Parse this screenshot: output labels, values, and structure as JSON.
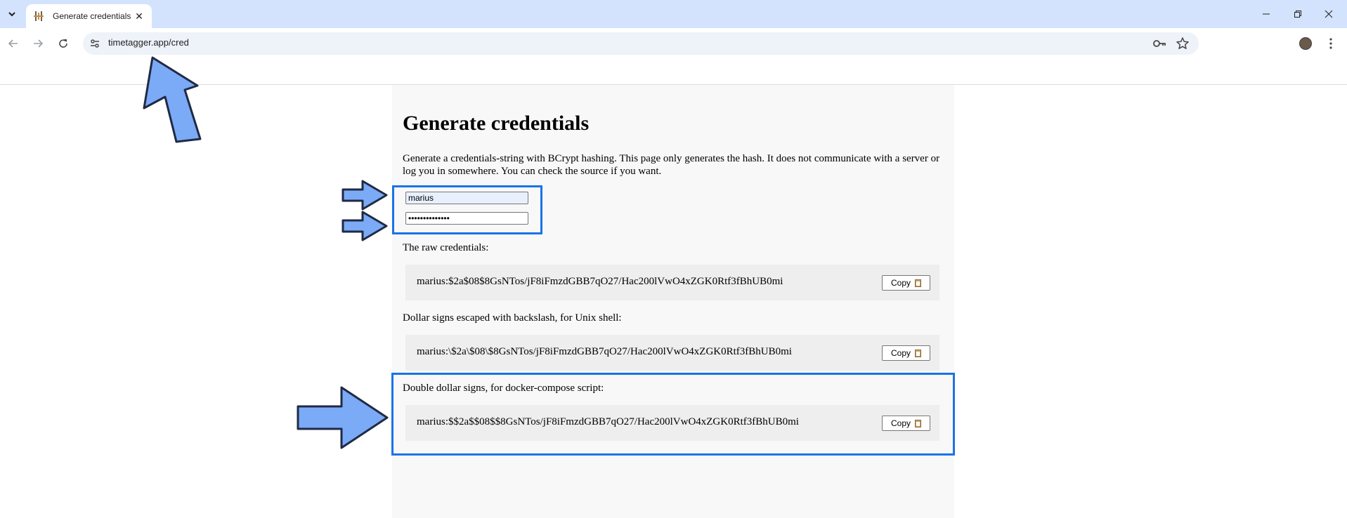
{
  "browser": {
    "tab_title": "Generate credentials",
    "tab_close": "✕",
    "url": "timetagger.app/cred"
  },
  "page": {
    "title": "Generate credentials",
    "intro": "Generate a credentials-string with BCrypt hashing. This page only generates the hash. It does not communicate with a server or log you in somewhere. You can check the source if you want.",
    "username_value": "marius",
    "password_value": "••••••••••••••",
    "raw_label": "The raw credentials:",
    "raw_value": "marius:$2a$08$8GsNTos/jF8iFmzdGBB7qO27/Hac200lVwO4xZGK0Rtf3fBhUB0mi",
    "escaped_label": "Dollar signs escaped with backslash, for Unix shell:",
    "escaped_value": "marius:\\$2a\\$08\\$8GsNTos/jF8iFmzdGBB7qO27/Hac200lVwO4xZGK0Rtf3fBhUB0mi",
    "docker_label": "Double dollar signs, for docker-compose script:",
    "docker_value": "marius:$$2a$$08$$8GsNTos/jF8iFmzdGBB7qO27/Hac200lVwO4xZGK0Rtf3fBhUB0mi",
    "copy_label": "Copy"
  },
  "colors": {
    "highlight": "#1a73e8",
    "arrow_fill": "#7baaf7",
    "tab_strip": "#d3e3fd"
  },
  "icons": [
    "chevron-down-icon",
    "favicon-icon",
    "close-icon",
    "minimize-icon",
    "restore-icon",
    "back-icon",
    "forward-icon",
    "reload-icon",
    "site-info-icon",
    "key-icon",
    "star-icon",
    "kebab-menu-icon",
    "clipboard-icon",
    "arrow-annotation"
  ]
}
